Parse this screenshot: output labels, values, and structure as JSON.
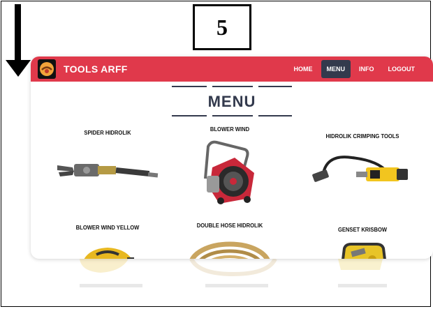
{
  "annotation": {
    "step_number": "5"
  },
  "navbar": {
    "brand": "TOOLS ARFF",
    "links": [
      {
        "label": "HOME",
        "active": false
      },
      {
        "label": "MENU",
        "active": true
      },
      {
        "label": "INFO",
        "active": false
      },
      {
        "label": "LOGOUT",
        "active": false
      }
    ]
  },
  "page": {
    "heading": "MENU"
  },
  "products": [
    {
      "name": "SPIDER HIDROLIK",
      "icon": "spider-hydraulic-tool-icon"
    },
    {
      "name": "BLOWER WIND",
      "icon": "blower-fan-icon"
    },
    {
      "name": "HIDROLIK CRIMPING TOOLS",
      "icon": "crimping-tool-icon"
    },
    {
      "name": "BLOWER WIND YELLOW",
      "icon": "yellow-blower-icon"
    },
    {
      "name": "DOUBLE HOSE HIDROLIK",
      "icon": "hose-coil-icon"
    },
    {
      "name": "GENSET KRISBOW",
      "icon": "genset-icon"
    }
  ],
  "colors": {
    "navbar": "#e0394b",
    "active_nav": "#333a4d",
    "heading": "#333a4d"
  }
}
